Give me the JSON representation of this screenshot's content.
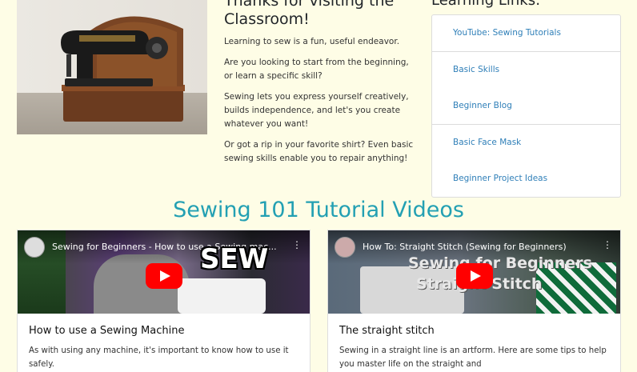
{
  "intro": {
    "title": "Thanks for visiting the Classroom!",
    "paragraphs": [
      "Learning to sew is a fun, useful endeavor.",
      "Are you looking to start from the beginning, or learn a specific skill?",
      "Sewing lets you express yourself creatively, builds independence, and let's you create whatever you want!",
      "Or got a rip in your favorite shirt? Even basic sewing skills enable you to repair anything!"
    ]
  },
  "links": {
    "title": "Learning Links:",
    "items": [
      {
        "label": "YouTube: Sewing Tutorials"
      },
      {
        "label": "Basic Skills"
      },
      {
        "label": "Beginner Blog"
      },
      {
        "label": "Basic Face Mask"
      },
      {
        "label": "Beginner Project Ideas"
      }
    ]
  },
  "videos": {
    "section_title": "Sewing 101 Tutorial Videos",
    "cards": [
      {
        "video_title": "Sewing for Beginners - How to use a Sewing mac...",
        "overlay": "SEW",
        "title": "How to use a Sewing Machine",
        "text": "As with using any machine, it's important to know how to use it safely."
      },
      {
        "video_title": "How To: Straight Stitch (Sewing for Beginners)",
        "overlay_1": "Sewing for Beginners",
        "overlay_2": "Straight Stitch",
        "title": "The straight stitch",
        "text": "Sewing in a straight line is an artform. Here are some tips to help you master life on the straight and"
      }
    ]
  },
  "colors": {
    "background": "#fefde6",
    "accent": "#23a0b3",
    "link": "#2f7fb8",
    "youtube_red": "#ff0000"
  },
  "icons": {
    "play": "youtube-play-icon",
    "menu": "more-vert-icon"
  }
}
